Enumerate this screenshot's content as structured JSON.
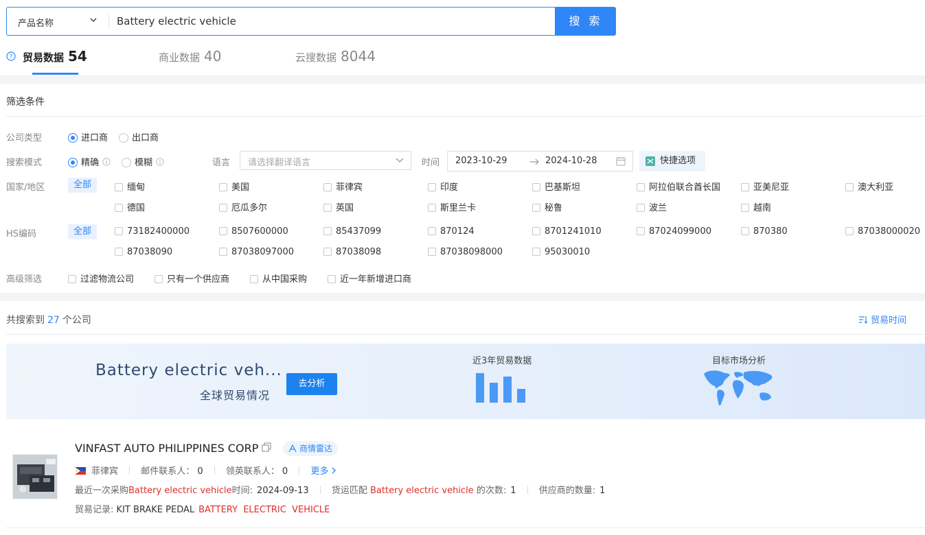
{
  "search": {
    "type_label": "产品名称",
    "query": "Battery electric vehicle",
    "button_label": "搜 索"
  },
  "tabs": [
    {
      "label": "贸易数据",
      "count": "54"
    },
    {
      "label": "商业数据",
      "count": "40"
    },
    {
      "label": "云搜数据",
      "count": "8044"
    }
  ],
  "filter": {
    "title": "筛选条件",
    "company_type_label": "公司类型",
    "company_types": [
      "进口商",
      "出口商"
    ],
    "search_mode_label": "搜索模式",
    "search_modes": [
      "精确",
      "模糊"
    ],
    "language_label": "语言",
    "language_placeholder": "请选择翻译语言",
    "time_label": "时间",
    "date_from": "2023-10-29",
    "date_to": "2024-10-28",
    "quick_label": "快捷选项",
    "country_label": "国家/地区",
    "all_label": "全部",
    "countries": [
      "缅甸",
      "美国",
      "菲律宾",
      "印度",
      "巴基斯坦",
      "阿拉伯联合酋长国",
      "亚美尼亚",
      "澳大利亚",
      "德国",
      "厄瓜多尔",
      "英国",
      "斯里兰卡",
      "秘鲁",
      "波兰",
      "越南"
    ],
    "hs_label": "HS编码",
    "hs_codes": [
      "73182400000",
      "8507600000",
      "85437099",
      "870124",
      "8701241010",
      "87024099000",
      "870380",
      "87038000020",
      "87038090",
      "87038097000",
      "87038098",
      "87038098000",
      "95030010"
    ],
    "advanced_label": "高级筛选",
    "advanced": [
      "过滤物流公司",
      "只有一个供应商",
      "从中国采购",
      "近一年新增进口商"
    ]
  },
  "results": {
    "prefix": "共搜索到",
    "count": "27",
    "suffix": "个公司",
    "sort_label": "贸易时间"
  },
  "banner": {
    "title": "Battery electric veh...",
    "subtitle": "全球贸易情况",
    "button": "去分析",
    "trade_label": "近3年贸易数据",
    "market_label": "目标市场分析"
  },
  "company": {
    "name": "VINFAST AUTO PHILIPPINES CORP",
    "radar_label": "商情雷达",
    "country": "菲律宾",
    "email_contacts_label": "邮件联系人：",
    "email_contacts": "0",
    "linkedin_contacts_label": "领英联系人：",
    "linkedin_contacts": "0",
    "more_label": "更多",
    "last_purchase_label": "最近一次采购",
    "keyword": "Battery electric vehicle",
    "time_label": "时间:",
    "last_purchase_date": "2024-09-13",
    "shipment_match_label": "货运匹配",
    "times_label": "的次数:",
    "match_count": "1",
    "supplier_count_label": "供应商的数量:",
    "supplier_count": "1",
    "trade_record_label": "贸易记录:",
    "trade_record_text": "KIT BRAKE PEDAL",
    "trade_record_highlight": "BATTERY  ELECTRIC  VEHICLE"
  }
}
